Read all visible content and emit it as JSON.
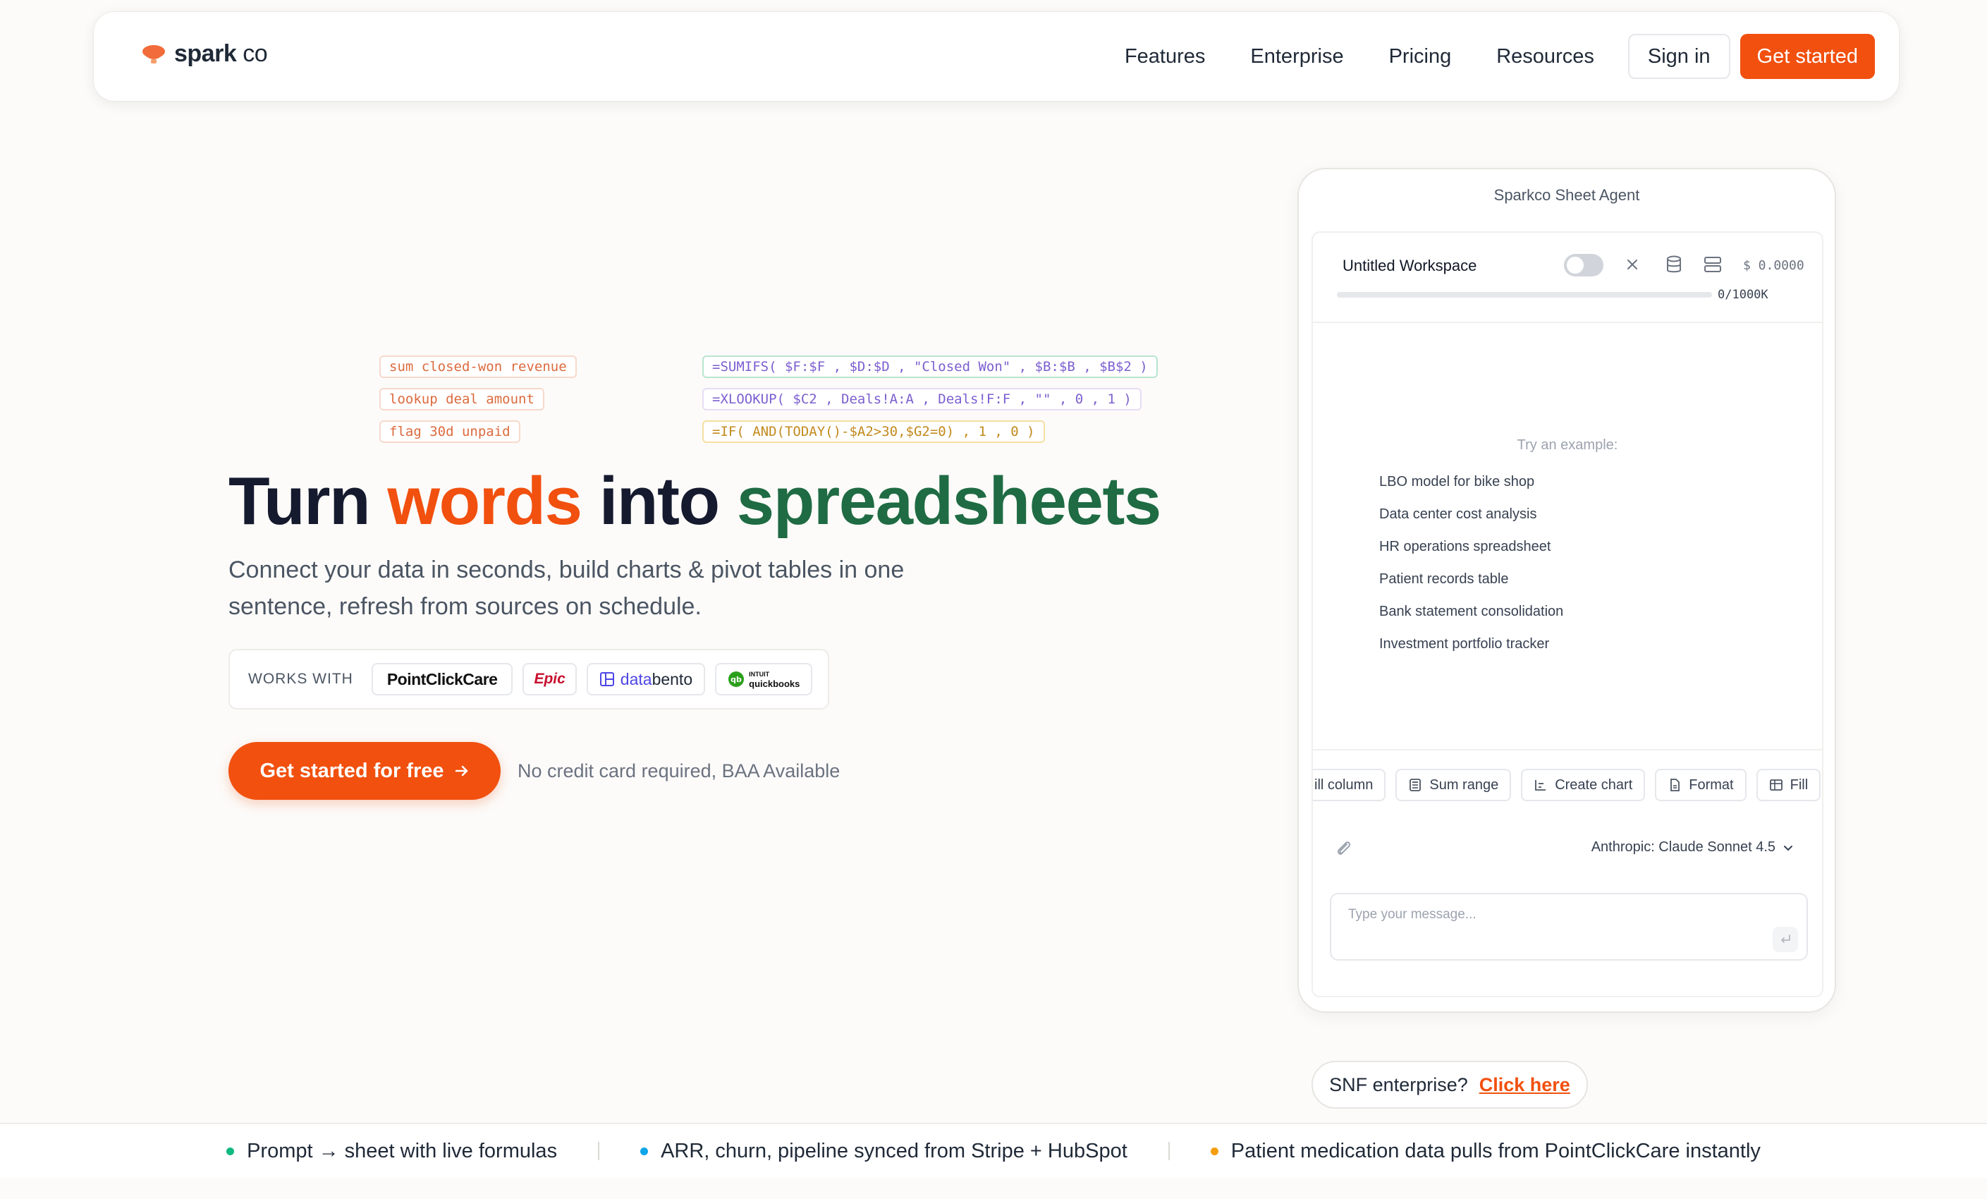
{
  "nav": {
    "logo_bold": "spark",
    "logo_light": "co",
    "links": [
      "Features",
      "Enterprise",
      "Pricing",
      "Resources"
    ],
    "signin_label": "Sign in",
    "getstarted_label": "Get started",
    "brand_color": "#f1500f"
  },
  "formulas": {
    "prompts": [
      "sum closed-won revenue",
      "lookup deal amount",
      "flag 30d unpaid"
    ],
    "formulas": [
      "=SUMIFS( $F:$F , $D:$D , \"Closed Won\" , $B:$B , $B$2 )",
      "=XLOOKUP( $C2 , Deals!A:A , Deals!F:F , \"\" , 0 , 1 )",
      "=IF( AND(TODAY()-$A2>30,$G2=0) , 1 , 0 )"
    ]
  },
  "hero": {
    "title_1": "Turn",
    "title_2": "words",
    "title_3": "into",
    "title_4": "spreadsheets",
    "subtitle": "Connect your data in seconds, build charts & pivot tables in one sentence, refresh from sources on schedule.",
    "works_with_label": "WORKS WITH",
    "partners": {
      "pcc": "PointClickCare",
      "epic": "Epic",
      "databento_a": "data",
      "databento_b": "bento",
      "qb_1": "INTUIT",
      "qb_2": "quickbooks"
    },
    "cta_label": "Get started for free",
    "cta_note": "No credit card required, BAA Available"
  },
  "agent": {
    "title": "Sparkco Sheet Agent",
    "workspace_name": "Untitled Workspace",
    "cost": "$ 0.0000",
    "tokens_label": "0/1000K",
    "tokens_used_fraction": 0,
    "try_label": "Try an example:",
    "examples": [
      "LBO model for bike shop",
      "Data center cost analysis",
      "HR operations spreadsheet",
      "Patient records table",
      "Bank statement consolidation",
      "Investment portfolio tracker"
    ],
    "actions": [
      "ill column",
      "Sum range",
      "Create chart",
      "Format",
      "Fill"
    ],
    "model_label": "Anthropic: Claude Sonnet 4.5",
    "message_placeholder": "Type your message..."
  },
  "snf": {
    "label": "SNF enterprise?",
    "link": "Click here"
  },
  "features": [
    {
      "text": "Prompt → sheet with live formulas",
      "color": "#10b981"
    },
    {
      "text": "ARR, churn, pipeline synced from Stripe + HubSpot",
      "color": "#0ea5e9"
    },
    {
      "text": "Patient medication data pulls from PointClickCare instantly",
      "color": "#f59e0b"
    }
  ]
}
